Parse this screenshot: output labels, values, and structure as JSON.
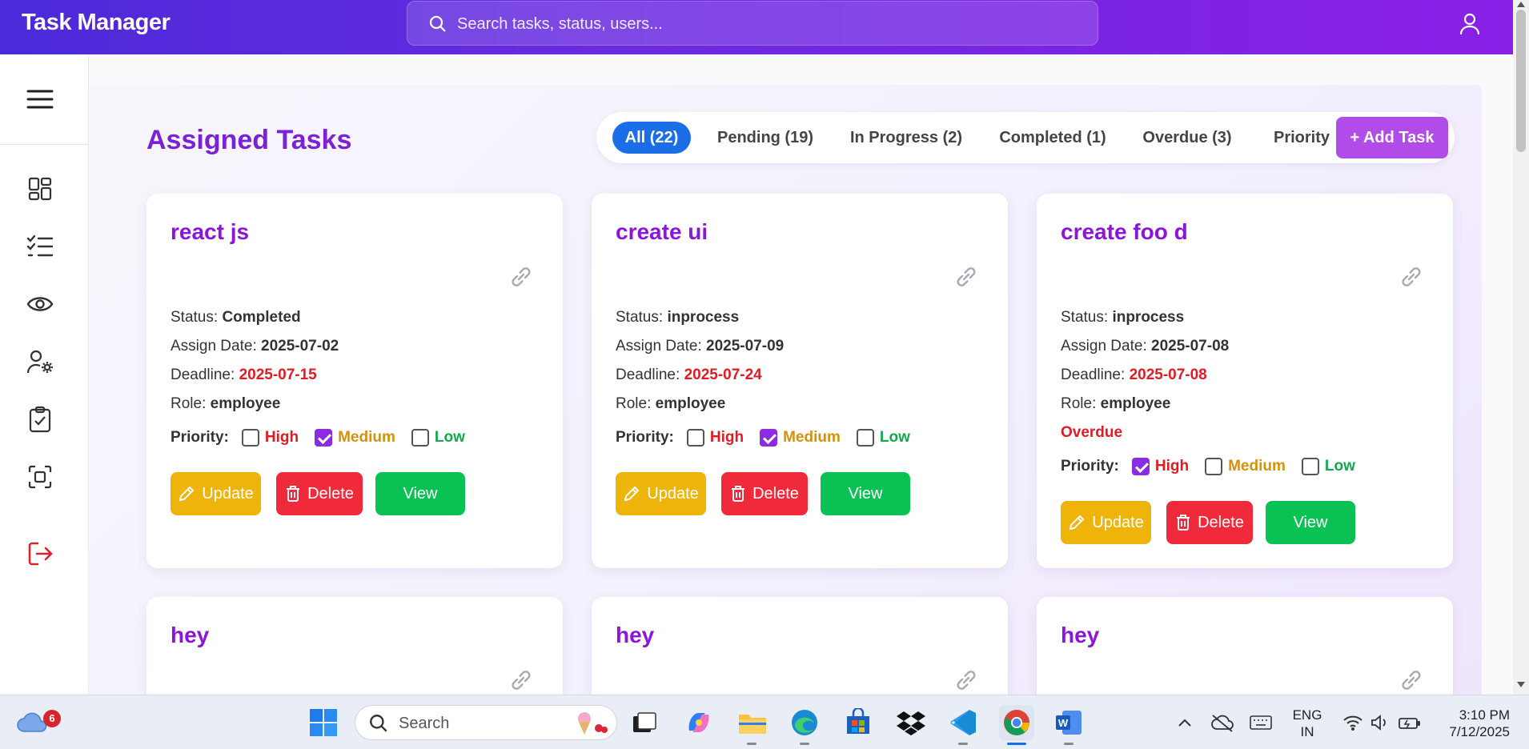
{
  "app": {
    "title": "Task Manager"
  },
  "search": {
    "placeholder": "Search tasks, status, users..."
  },
  "page": {
    "title": "Assigned Tasks"
  },
  "filters": {
    "tabs": [
      {
        "label": "All (22)",
        "active": true
      },
      {
        "label": "Pending (19)",
        "active": false
      },
      {
        "label": "In Progress (2)",
        "active": false
      },
      {
        "label": "Completed (1)",
        "active": false
      },
      {
        "label": "Overdue (3)",
        "active": false
      }
    ],
    "priority_label": "Priority",
    "add_label": "+ Add Task"
  },
  "labels": {
    "status": "Status:",
    "assign_date": "Assign Date:",
    "deadline": "Deadline:",
    "role": "Role:",
    "priority": "Priority:",
    "high": "High",
    "medium": "Medium",
    "low": "Low",
    "update": "Update",
    "delete": "Delete",
    "view": "View"
  },
  "tasks": [
    {
      "title": "react js",
      "status": "Completed",
      "assign_date": "2025-07-02",
      "deadline": "2025-07-15",
      "role": "employee",
      "overdue": "",
      "priority": "Medium"
    },
    {
      "title": "create ui",
      "status": "inprocess",
      "assign_date": "2025-07-09",
      "deadline": "2025-07-24",
      "role": "employee",
      "overdue": "",
      "priority": "Medium"
    },
    {
      "title": "create foo d",
      "status": "inprocess",
      "assign_date": "2025-07-08",
      "deadline": "2025-07-08",
      "role": "employee",
      "overdue": "Overdue",
      "priority": "High"
    },
    {
      "title": "hey"
    },
    {
      "title": "hey"
    },
    {
      "title": "hey"
    }
  ],
  "sidebar": {
    "icons": [
      "menu-icon",
      "dashboard-icon",
      "task-list-icon",
      "eye-icon",
      "user-settings-icon",
      "clipboard-check-icon",
      "scan-icon",
      "logout-icon"
    ]
  },
  "taskbar": {
    "weather_badge": "6",
    "search_label": "Search",
    "lang_top": "ENG",
    "lang_bottom": "IN",
    "time": "3:10 PM",
    "date": "7/12/2025"
  },
  "colors": {
    "header_start": "#4b2ad9",
    "header_end": "#8a1fe6",
    "accent": "#7b22d6",
    "active_tab": "#1a6ee8",
    "update": "#efb409",
    "delete": "#f02a3a",
    "view": "#0ac254"
  }
}
